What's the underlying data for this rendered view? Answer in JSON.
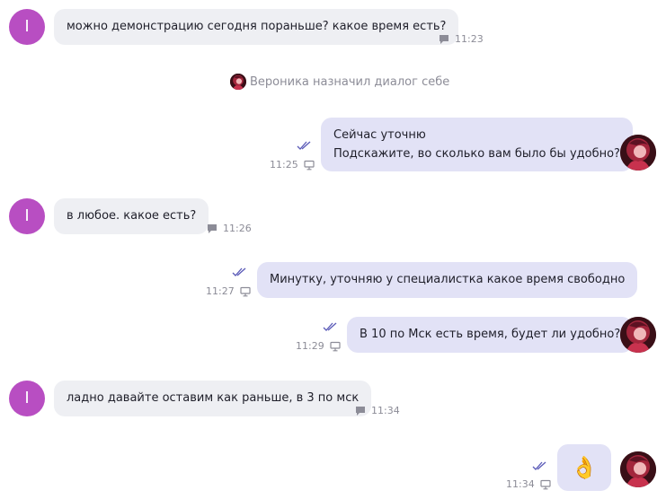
{
  "colors": {
    "incoming_bubble": "#eeeff3",
    "outgoing_bubble": "#e2e2f6",
    "contact_avatar": "#b84ec2",
    "meta_text": "#8c8c97"
  },
  "contact": {
    "avatar_letter": "I"
  },
  "system_note": {
    "text": "Вероника назначил диалог себе"
  },
  "messages": [
    {
      "lines": [
        "можно демонстрацию сегодня пораньше? какое время есть?"
      ],
      "time": "11:23",
      "channel_icon": "chat-icon"
    },
    {
      "lines": [
        "Сейчас уточню",
        "Подскажите, во сколько вам было бы удобно?"
      ],
      "time": "11:25",
      "channel_icon": "monitor-icon",
      "status_icon": "double-check-icon"
    },
    {
      "lines": [
        "в любое. какое есть?"
      ],
      "time": "11:26",
      "channel_icon": "chat-icon"
    },
    {
      "lines": [
        "Минутку, уточняю у специалистка какое время свободно"
      ],
      "time": "11:27",
      "channel_icon": "monitor-icon",
      "status_icon": "double-check-icon"
    },
    {
      "lines": [
        "В 10 по Мск есть время, будет ли удобно?"
      ],
      "time": "11:29",
      "channel_icon": "monitor-icon",
      "status_icon": "double-check-icon"
    },
    {
      "lines": [
        "ладно давайте оставим как раньше, в 3 по мск"
      ],
      "time": "11:34",
      "channel_icon": "chat-icon"
    },
    {
      "lines": [
        "👌"
      ],
      "time": "11:34",
      "channel_icon": "monitor-icon",
      "status_icon": "double-check-icon"
    }
  ]
}
